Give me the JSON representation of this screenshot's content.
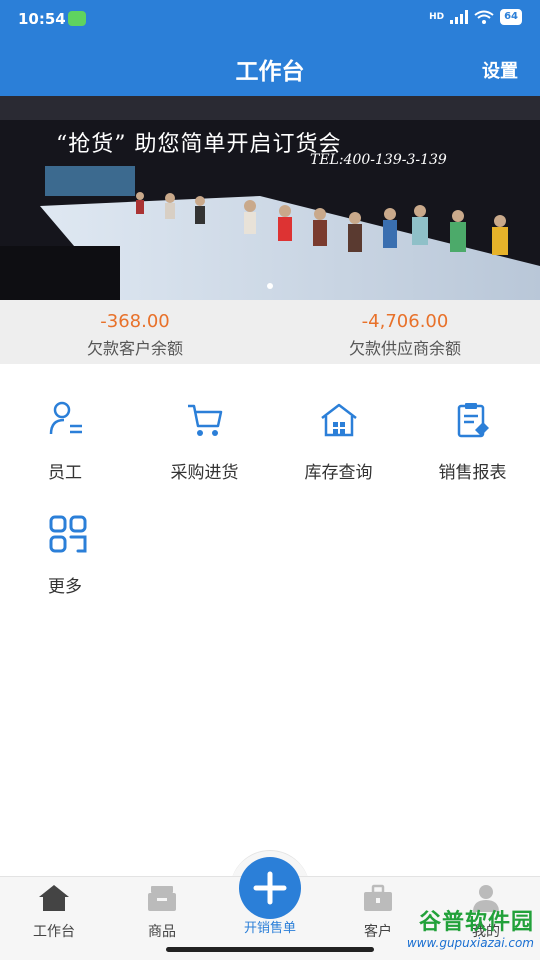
{
  "status": {
    "time": "10:54",
    "signal": "HD",
    "battery": "64"
  },
  "header": {
    "title": "工作台",
    "settings_label": "设置"
  },
  "banner": {
    "headline": "“抢货” 助您简单开启订货会",
    "tel": "TEL:400-139-3-139"
  },
  "balances": [
    {
      "amount": "-368.00",
      "label": "欠款客户余额"
    },
    {
      "amount": "-4,706.00",
      "label": "欠款供应商余额"
    }
  ],
  "menu": [
    {
      "label": "员工",
      "icon": "staff-icon"
    },
    {
      "label": "采购进货",
      "icon": "cart-icon"
    },
    {
      "label": "库存查询",
      "icon": "warehouse-icon"
    },
    {
      "label": "销售报表",
      "icon": "report-icon"
    },
    {
      "label": "更多",
      "icon": "grid-icon"
    }
  ],
  "tabs": [
    {
      "label": "工作台",
      "icon": "home-icon",
      "active": true
    },
    {
      "label": "商品",
      "icon": "box-icon"
    },
    {
      "label": "开销售单",
      "icon": "plus-icon"
    },
    {
      "label": "客户",
      "icon": "briefcase-icon"
    },
    {
      "label": "我的",
      "icon": "user-icon"
    }
  ],
  "watermark": {
    "name": "谷普软件园",
    "url": "www.gupuxiazai.com"
  },
  "colors": {
    "primary": "#2b7fd8",
    "amount": "#e8712a",
    "watermark_green": "#22a13a"
  }
}
